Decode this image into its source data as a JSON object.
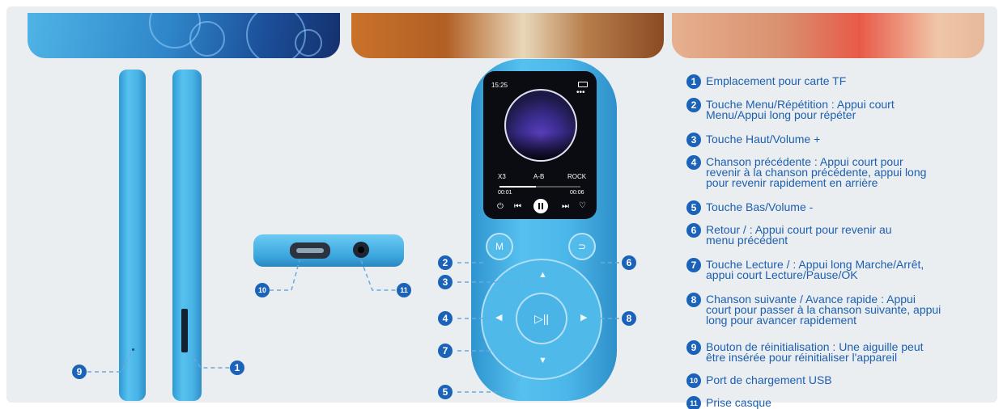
{
  "colors": {
    "accent": "#1b63b8",
    "device_blue": "#4bb7ea",
    "panel_bg": "#eaeef1"
  },
  "screen": {
    "time": "15:25",
    "repeat": "X3",
    "ab": "A-B",
    "genre": "ROCK",
    "elapsed": "00:01",
    "total": "00:06",
    "progress": 0.45,
    "icons": [
      "battery-icon",
      "more-icon",
      "shuffle-icon",
      "prev-icon",
      "pause-icon",
      "next-icon",
      "heart-icon"
    ]
  },
  "buttons": {
    "menu": "M",
    "back": "⊃",
    "center": "▷||"
  },
  "callout_numbers": [
    "1",
    "2",
    "3",
    "4",
    "5",
    "6",
    "7",
    "8",
    "9",
    "10",
    "11"
  ],
  "legend": [
    {
      "num": "1",
      "lines": [
        "Emplacement pour carte TF"
      ]
    },
    {
      "num": "2",
      "lines": [
        "Touche Menu/Répétition : Appui court",
        "Menu/Appui long pour répéter"
      ]
    },
    {
      "num": "3",
      "lines": [
        "Touche Haut/Volume +"
      ]
    },
    {
      "num": "4",
      "lines": [
        "Chanson précédente : Appui court pour",
        "revenir à la chanson précédente, appui long",
        "pour revenir rapidement en arrière"
      ]
    },
    {
      "num": "5",
      "lines": [
        "Touche Bas/Volume -"
      ]
    },
    {
      "num": "6",
      "lines": [
        "Retour / : Appui court pour revenir au",
        "menu précédent"
      ]
    },
    {
      "num": "7",
      "lines": [
        "Touche Lecture / : Appui long Marche/Arrêt,",
        "appui court Lecture/Pause/OK"
      ]
    },
    {
      "num": "8",
      "lines": [
        "Chanson suivante / Avance rapide : Appui",
        "court pour passer à la chanson suivante, appui",
        "long pour avancer rapidement"
      ]
    },
    {
      "num": "9",
      "lines": [
        "Bouton de réinitialisation : Une aiguille peut",
        "être insérée pour réinitialiser l'appareil"
      ]
    },
    {
      "num": "10",
      "lines": [
        "Port de chargement USB"
      ]
    },
    {
      "num": "11",
      "lines": [
        "Prise casque"
      ]
    }
  ]
}
